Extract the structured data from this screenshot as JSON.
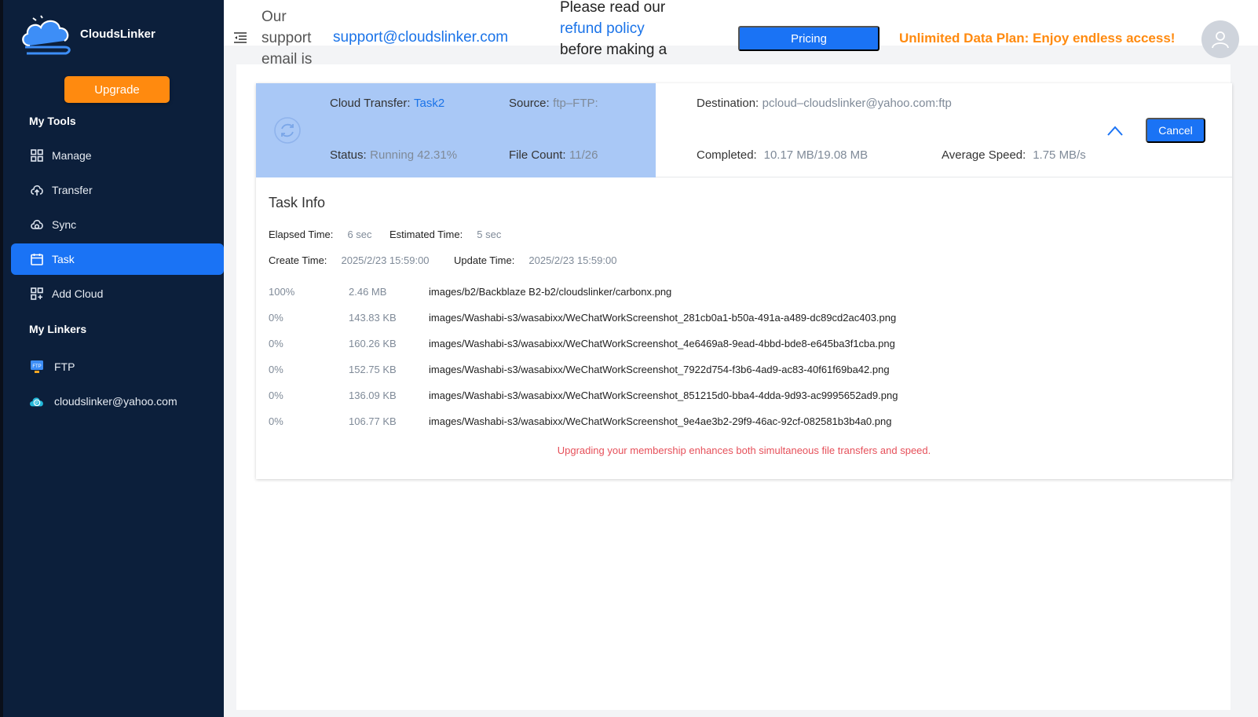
{
  "brand": {
    "name": "CloudsLinker"
  },
  "sidebar": {
    "upgrade_label": "Upgrade",
    "tools_heading": "My Tools",
    "items": [
      {
        "label": "Manage",
        "icon": "grid-icon"
      },
      {
        "label": "Transfer",
        "icon": "cloud-upload-icon"
      },
      {
        "label": "Sync",
        "icon": "cloud-sync-icon"
      },
      {
        "label": "Task",
        "icon": "calendar-icon",
        "active": true
      },
      {
        "label": "Add Cloud",
        "icon": "add-grid-icon"
      }
    ],
    "linkers_heading": "My Linkers",
    "linkers": [
      {
        "label": "FTP",
        "icon": "ftp-icon"
      },
      {
        "label": "cloudslinker@yahoo.com",
        "icon": "pcloud-icon"
      }
    ]
  },
  "header": {
    "support_text": "Our support email is",
    "support_email": "support@cloudslinker.com",
    "refund_prefix": "Please read our",
    "refund_link": "refund policy",
    "refund_suffix": "before making a",
    "pricing_label": "Pricing",
    "promo": "Unlimited Data Plan: Enjoy endless access!"
  },
  "task": {
    "cloud_transfer_label": "Cloud Transfer:",
    "cloud_transfer_value": "Task2",
    "source_label": "Source:",
    "source_value": "ftp–FTP:",
    "status_label": "Status:",
    "status_value": "Running 42.31%",
    "file_count_label": "File Count:",
    "file_count_value": "11/26",
    "destination_label": "Destination:",
    "destination_value": "pcloud–cloudslinker@yahoo.com:ftp",
    "completed_label": "Completed:",
    "completed_value": "10.17 MB/19.08 MB",
    "avg_speed_label": "Average Speed:",
    "avg_speed_value": "1.75 MB/s",
    "cancel_label": "Cancel"
  },
  "task_info": {
    "title": "Task Info",
    "elapsed_label": "Elapsed Time:",
    "elapsed_value": "6 sec",
    "estimated_label": "Estimated Time:",
    "estimated_value": "5 sec",
    "create_label": "Create Time:",
    "create_value": "2025/2/23 15:59:00",
    "update_label": "Update Time:",
    "update_value": "2025/2/23 15:59:00"
  },
  "files": [
    {
      "pct": "100%",
      "size": "2.46 MB",
      "path": "images/b2/Backblaze B2-b2/cloudslinker/carbonx.png"
    },
    {
      "pct": "0%",
      "size": "143.83 KB",
      "path": "images/Washabi-s3/wasabixx/WeChatWorkScreenshot_281cb0a1-b50a-491a-a489-dc89cd2ac403.png"
    },
    {
      "pct": "0%",
      "size": "160.26 KB",
      "path": "images/Washabi-s3/wasabixx/WeChatWorkScreenshot_4e6469a8-9ead-4bbd-bde8-e645ba3f1cba.png"
    },
    {
      "pct": "0%",
      "size": "152.75 KB",
      "path": "images/Washabi-s3/wasabixx/WeChatWorkScreenshot_7922d754-f3b6-4ad9-ac83-40f61f69ba42.png"
    },
    {
      "pct": "0%",
      "size": "136.09 KB",
      "path": "images/Washabi-s3/wasabixx/WeChatWorkScreenshot_851215d0-bba4-4dda-9d93-ac9995652ad9.png"
    },
    {
      "pct": "0%",
      "size": "106.77 KB",
      "path": "images/Washabi-s3/wasabixx/WeChatWorkScreenshot_9e4ae3b2-29f9-46ac-92cf-082581b3b4a0.png"
    }
  ],
  "notice": "Upgrading your membership enhances both simultaneous file transfers and speed.",
  "colors": {
    "accent": "#1a73f5",
    "sidebar_bg": "#0c1f3b",
    "orange": "#ff8a0f",
    "task_head_bg": "#a9c8f6",
    "notice": "#e6505a"
  }
}
